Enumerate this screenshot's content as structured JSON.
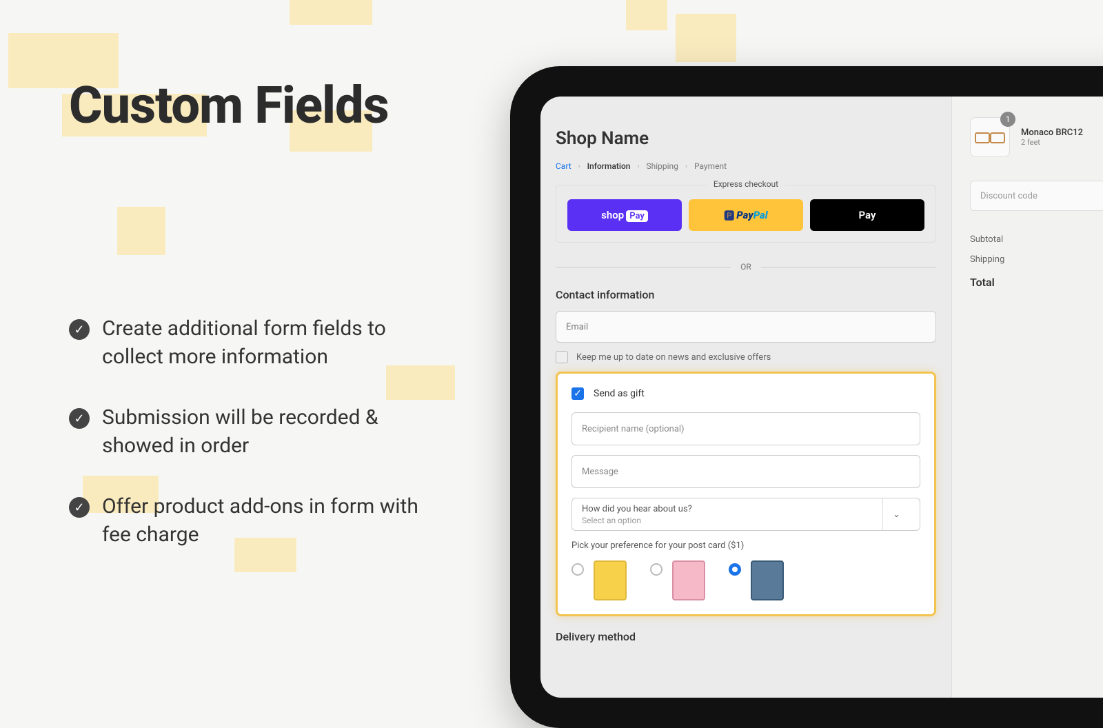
{
  "hero": {
    "title": "Custom Fields",
    "features": [
      "Create additional form fields to collect more information",
      "Submission will be recorded & showed in order",
      "Offer product add-ons in form with fee charge"
    ]
  },
  "checkout": {
    "shop_name": "Shop Name",
    "breadcrumbs": {
      "cart": "Cart",
      "information": "Information",
      "shipping": "Shipping",
      "payment": "Payment"
    },
    "express_label": "Express checkout",
    "payments": {
      "shoppay": "shop Pay",
      "paypal_a": "Pay",
      "paypal_b": "Pal",
      "apple": " Pay"
    },
    "or": "OR",
    "contact_title": "Contact information",
    "email_placeholder": "Email",
    "newsletter": "Keep me up to date on news and exclusive offers",
    "gift": {
      "label": "Send as gift",
      "recipient_ph": "Recipient name (optional)",
      "message_ph": "Message",
      "hear_q": "How did you hear about us?",
      "hear_sel": "Select an option",
      "postcard_label": "Pick your preference for your post card ($1)"
    },
    "delivery_title": "Delivery method",
    "side": {
      "item_name": "Monaco BRC12",
      "item_variant": "2 feet",
      "item_qty": "1",
      "discount_ph": "Discount code",
      "subtotal": "Subtotal",
      "shipping": "Shipping",
      "total": "Total"
    }
  }
}
